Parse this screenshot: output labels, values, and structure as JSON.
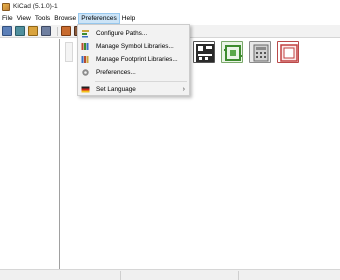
{
  "window": {
    "title": "KiCad (5.1.0)-1"
  },
  "menubar": {
    "items": [
      {
        "label": "File"
      },
      {
        "label": "View"
      },
      {
        "label": "Tools"
      },
      {
        "label": "Browse"
      },
      {
        "label": "Preferences"
      },
      {
        "label": "Help"
      }
    ]
  },
  "preferences_menu": {
    "items": [
      {
        "label": "Configure Paths...",
        "icon": "configure-paths-icon"
      },
      {
        "label": "Manage Symbol Libraries...",
        "icon": "symbol-libraries-icon"
      },
      {
        "label": "Manage Footprint Libraries...",
        "icon": "footprint-libraries-icon"
      },
      {
        "label": "Preferences...",
        "icon": "gear-icon"
      },
      {
        "label": "Set Language",
        "icon": "language-flag-icon",
        "submenu_arrow": "›"
      }
    ]
  },
  "colors": {
    "menu_highlight": "#cce4f7",
    "toolbar_bg": "#f2f2f2",
    "menu_bg": "#f2f2f2"
  }
}
